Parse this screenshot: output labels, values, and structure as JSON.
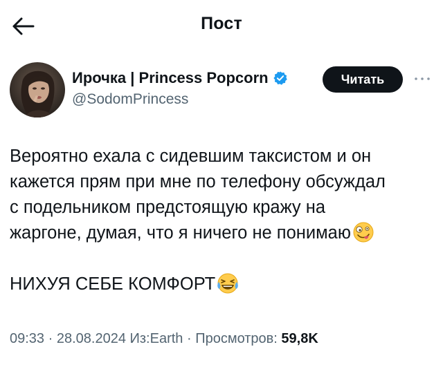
{
  "header": {
    "title": "Пост",
    "back_icon": "arrow-left-icon"
  },
  "author": {
    "display_name": "Ирочка | Princess Popcorn",
    "handle": "@SodomPrincess",
    "verified": true,
    "verified_color": "#1d9bf0",
    "follow_label": "Читать",
    "more_icon": "more-dots-icon"
  },
  "tweet": {
    "lines": [
      "Вероятно ехала с сидевшим таксистом и он",
      "кажется прям при мне по телефону обсуждал",
      "с подельником предстоящую кражу на",
      "жаргоне, думая, что я ничего не понимаю"
    ],
    "emoji_1": "zany-face-emoji",
    "paragraph_2": "НИХУЯ СЕБЕ КОМФОРТ",
    "emoji_2": "laughing-tears-emoji"
  },
  "meta": {
    "time": "09:33",
    "sep1": " · ",
    "date": "28.08.2024",
    "source_prefix": " Из:",
    "source": "Earth",
    "sep2": " · ",
    "views_label": "Просмотров: ",
    "views_count": "59,8K"
  },
  "colors": {
    "text": "#0f1419",
    "secondary": "#536471",
    "follow_bg": "#0f1419"
  }
}
